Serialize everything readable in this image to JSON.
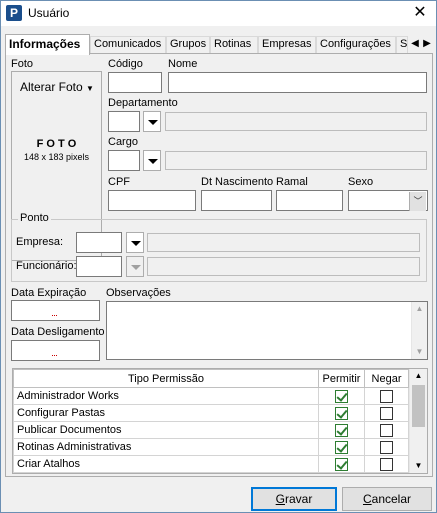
{
  "window": {
    "title": "Usuário",
    "app_icon": "P"
  },
  "tabs": [
    {
      "label": "Informações",
      "active": true
    },
    {
      "label": "Comunicados"
    },
    {
      "label": "Grupos"
    },
    {
      "label": "Rotinas"
    },
    {
      "label": "Empresas"
    },
    {
      "label": "Configurações"
    },
    {
      "label": "S"
    }
  ],
  "photo": {
    "label": "Foto",
    "change_button": "Alterar Foto",
    "placeholder_title": "F O T O",
    "placeholder_size": "148 x 183 pixels"
  },
  "fields": {
    "codigo": {
      "label": "Código",
      "value": ""
    },
    "nome": {
      "label": "Nome",
      "value": ""
    },
    "departamento": {
      "label": "Departamento",
      "value": ""
    },
    "cargo": {
      "label": "Cargo",
      "value": ""
    },
    "cpf": {
      "label": "CPF",
      "value": ""
    },
    "dt_nascimento": {
      "label": "Dt Nascimento",
      "value": ""
    },
    "ramal": {
      "label": "Ramal",
      "value": ""
    },
    "sexo": {
      "label": "Sexo",
      "value": ""
    }
  },
  "ponto": {
    "title": "Ponto",
    "empresa_label": "Empresa:",
    "funcionario_label": "Funcionário:"
  },
  "dates": {
    "expiracao_label": "Data Expiração",
    "desligamento_label": "Data Desligamento"
  },
  "observacoes_label": "Observações",
  "permissions": {
    "headers": {
      "tipo": "Tipo Permissão",
      "permitir": "Permitir",
      "negar": "Negar"
    },
    "rows": [
      {
        "name": "Administrador Works",
        "permitir": true,
        "negar": false
      },
      {
        "name": "Configurar Pastas",
        "permitir": true,
        "negar": false
      },
      {
        "name": "Publicar Documentos",
        "permitir": true,
        "negar": false
      },
      {
        "name": "Rotinas Administrativas",
        "permitir": true,
        "negar": false
      },
      {
        "name": "Criar Atalhos",
        "permitir": true,
        "negar": false
      }
    ]
  },
  "buttons": {
    "save": "Gravar",
    "save_underline": "G",
    "cancel": "Cancelar",
    "cancel_underline": "C"
  },
  "colors": {
    "accent": "#0078d7",
    "check": "#2e7d32",
    "app_icon_bg": "#1a4e8c"
  }
}
